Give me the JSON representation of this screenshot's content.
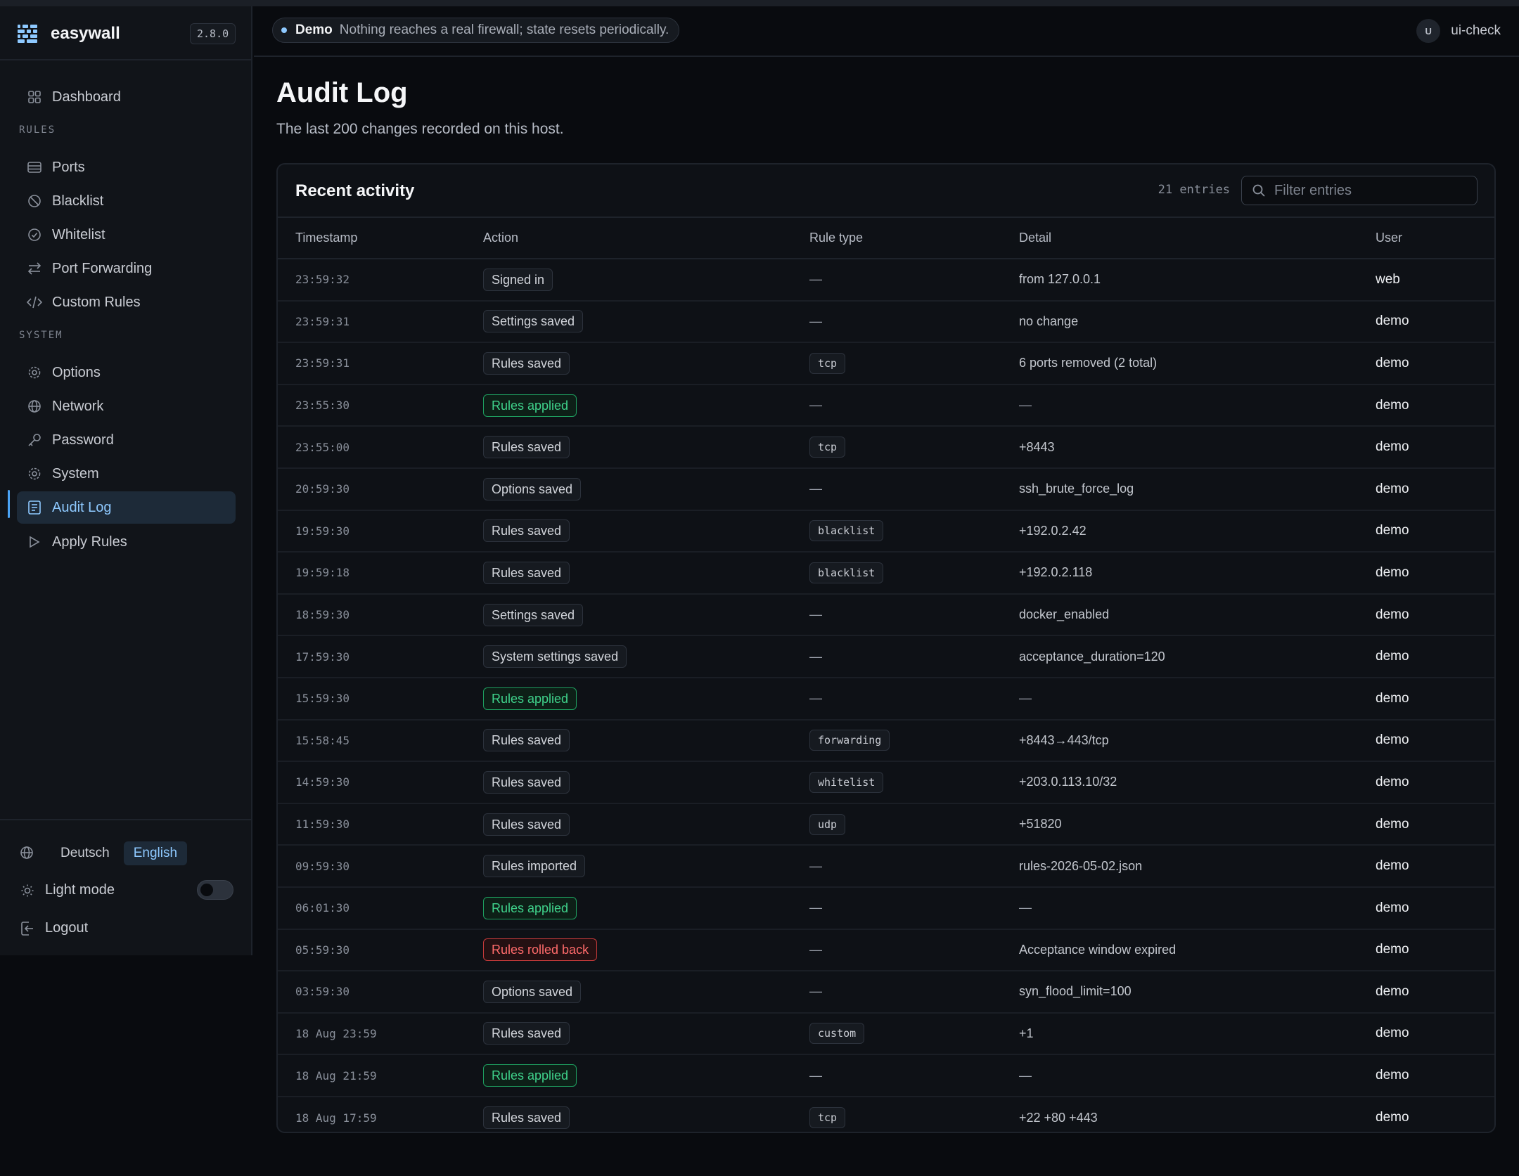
{
  "app": {
    "name": "easywall",
    "version": "2.8.0"
  },
  "nav": {
    "dashboard": "Dashboard",
    "rules_section": "RULES",
    "rules": [
      "Ports",
      "Blacklist",
      "Whitelist",
      "Port Forwarding",
      "Custom Rules"
    ],
    "system_section": "SYSTEM",
    "system": [
      "Options",
      "Network",
      "Password",
      "System",
      "Audit Log",
      "Apply Rules"
    ],
    "active": "Audit Log"
  },
  "footer": {
    "languages": [
      "Deutsch",
      "English"
    ],
    "selected_language": "English",
    "light_mode_label": "Light mode",
    "light_mode_on": false,
    "logout_label": "Logout"
  },
  "topbar": {
    "demo_label": "Demo",
    "demo_message": "Nothing reaches a real firewall; state resets periodically.",
    "user_initial": "U",
    "user_name": "ui-check"
  },
  "page": {
    "title": "Audit Log",
    "subtitle": "The last 200 changes recorded on this host."
  },
  "card": {
    "title": "Recent activity",
    "entries_label": "21 entries",
    "filter_placeholder": "Filter entries"
  },
  "table": {
    "columns": [
      "Timestamp",
      "Action",
      "Rule type",
      "Detail",
      "User"
    ],
    "rows": [
      {
        "ts": "23:59:32",
        "action": "Signed in",
        "kind": "neutral",
        "rule_type": "",
        "detail": "from 127.0.0.1",
        "user": "web"
      },
      {
        "ts": "23:59:31",
        "action": "Settings saved",
        "kind": "neutral",
        "rule_type": "",
        "detail": "no change",
        "user": "demo"
      },
      {
        "ts": "23:59:31",
        "action": "Rules saved",
        "kind": "neutral",
        "rule_type": "tcp",
        "detail": "6 ports removed (2 total)",
        "user": "demo"
      },
      {
        "ts": "23:55:30",
        "action": "Rules applied",
        "kind": "applied",
        "rule_type": "",
        "detail": "",
        "user": "demo"
      },
      {
        "ts": "23:55:00",
        "action": "Rules saved",
        "kind": "neutral",
        "rule_type": "tcp",
        "detail": "+8443",
        "user": "demo"
      },
      {
        "ts": "20:59:30",
        "action": "Options saved",
        "kind": "neutral",
        "rule_type": "",
        "detail": "ssh_brute_force_log",
        "user": "demo"
      },
      {
        "ts": "19:59:30",
        "action": "Rules saved",
        "kind": "neutral",
        "rule_type": "blacklist",
        "detail": "+192.0.2.42",
        "user": "demo"
      },
      {
        "ts": "19:59:18",
        "action": "Rules saved",
        "kind": "neutral",
        "rule_type": "blacklist",
        "detail": "+192.0.2.118",
        "user": "demo"
      },
      {
        "ts": "18:59:30",
        "action": "Settings saved",
        "kind": "neutral",
        "rule_type": "",
        "detail": "docker_enabled",
        "user": "demo"
      },
      {
        "ts": "17:59:30",
        "action": "System settings saved",
        "kind": "neutral",
        "rule_type": "",
        "detail": "acceptance_duration=120",
        "user": "demo"
      },
      {
        "ts": "15:59:30",
        "action": "Rules applied",
        "kind": "applied",
        "rule_type": "",
        "detail": "",
        "user": "demo"
      },
      {
        "ts": "15:58:45",
        "action": "Rules saved",
        "kind": "neutral",
        "rule_type": "forwarding",
        "detail": "+8443→443/tcp",
        "user": "demo"
      },
      {
        "ts": "14:59:30",
        "action": "Rules saved",
        "kind": "neutral",
        "rule_type": "whitelist",
        "detail": "+203.0.113.10/32",
        "user": "demo"
      },
      {
        "ts": "11:59:30",
        "action": "Rules saved",
        "kind": "neutral",
        "rule_type": "udp",
        "detail": "+51820",
        "user": "demo"
      },
      {
        "ts": "09:59:30",
        "action": "Rules imported",
        "kind": "neutral",
        "rule_type": "",
        "detail": "rules-2026-05-02.json",
        "user": "demo"
      },
      {
        "ts": "06:01:30",
        "action": "Rules applied",
        "kind": "applied",
        "rule_type": "",
        "detail": "",
        "user": "demo"
      },
      {
        "ts": "05:59:30",
        "action": "Rules rolled back",
        "kind": "rolledback",
        "rule_type": "",
        "detail": "Acceptance window expired",
        "user": "demo"
      },
      {
        "ts": "03:59:30",
        "action": "Options saved",
        "kind": "neutral",
        "rule_type": "",
        "detail": "syn_flood_limit=100",
        "user": "demo"
      },
      {
        "ts": "18 Aug 23:59",
        "action": "Rules saved",
        "kind": "neutral",
        "rule_type": "custom",
        "detail": "+1",
        "user": "demo"
      },
      {
        "ts": "18 Aug 21:59",
        "action": "Rules applied",
        "kind": "applied",
        "rule_type": "",
        "detail": "",
        "user": "demo"
      },
      {
        "ts": "18 Aug 17:59",
        "action": "Rules saved",
        "kind": "neutral",
        "rule_type": "tcp",
        "detail": "+22 +80 +443",
        "user": "demo"
      }
    ],
    "empty_glyph": "—"
  },
  "colors": {
    "accent": "#8ec9ff",
    "applied": "#3fd28b",
    "rolledback": "#ff6b6b"
  }
}
